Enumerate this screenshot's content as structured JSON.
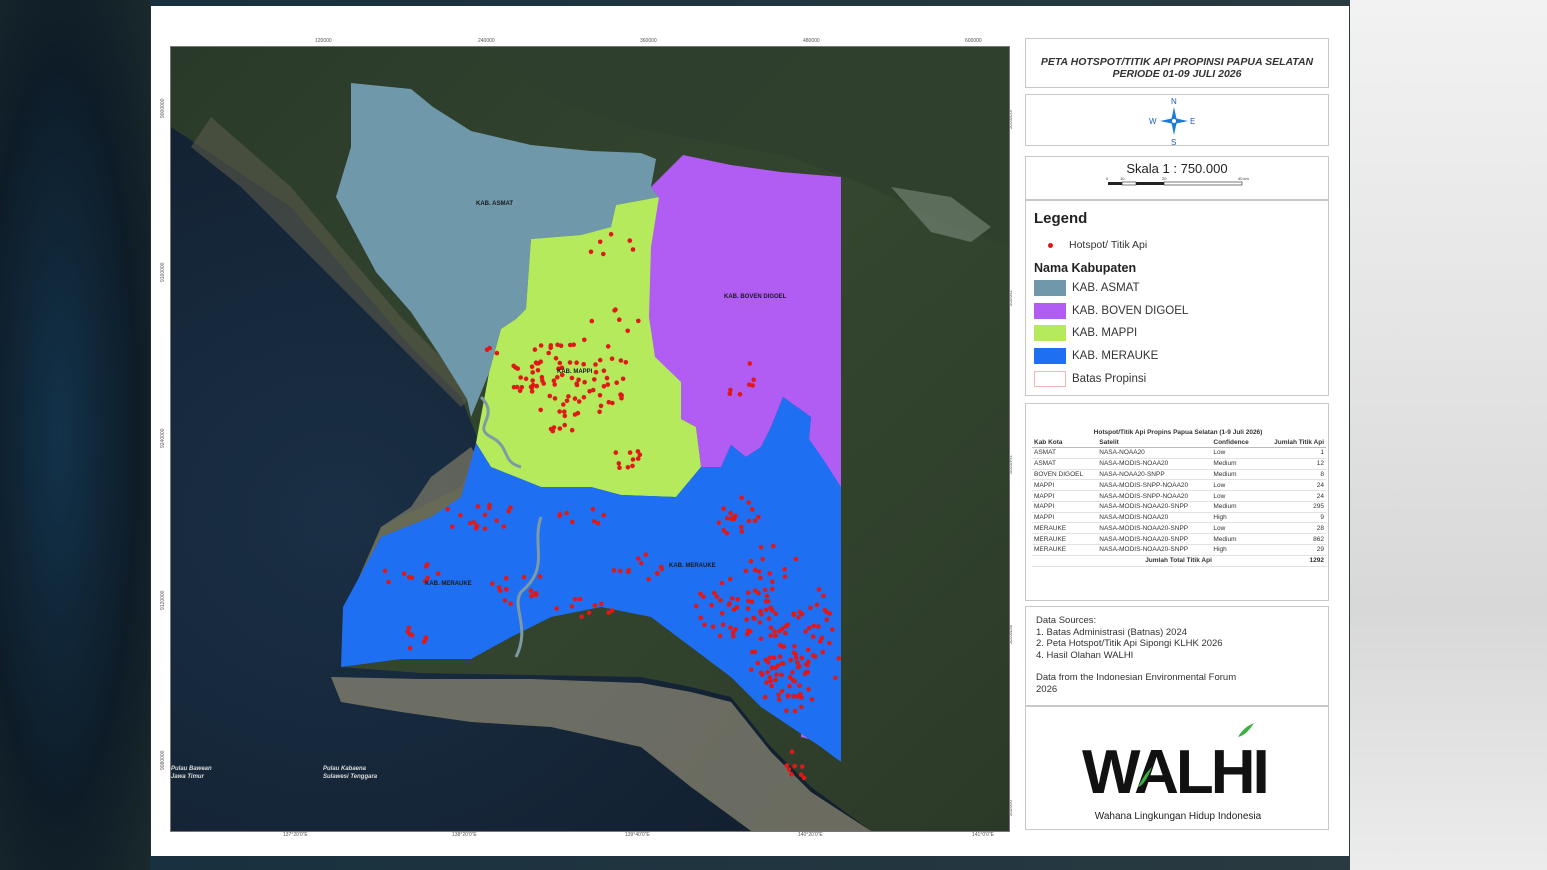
{
  "map": {
    "title_line1": "PETA HOTSPOT/TITIK API PROPINSI PAPUA SELATAN",
    "title_line2": "PERIODE 01-09 JULI 2026",
    "north_arrow": {
      "icon": "compass-rose-icon",
      "n": "N",
      "s": "S",
      "e": "E",
      "w": "W"
    },
    "scale": "Skala 1 : 750.000",
    "scale_bar_ticks": [
      "0",
      "10",
      "20",
      "40 km"
    ],
    "grid_ticks_top": [
      "120000",
      "240000",
      "360000",
      "480000",
      "600000"
    ],
    "grid_ticks_bottom": [
      "137°20'0\"E",
      "138°20'0\"E",
      "139°40'0\"E",
      "140°20'0\"E",
      "141°0'0\"E"
    ],
    "grid_ticks_left": [
      "9000000",
      "9160000",
      "9240000",
      "9120000",
      "9080000"
    ],
    "grid_ticks_right": [
      "6°20'0\"S",
      "7°0'0\"S",
      "7°40'0\"S",
      "8°20'0\"S",
      "9°0'0\"S"
    ],
    "region_labels": {
      "asmat": "KAB. ASMAT",
      "boven": "KAB. BOVEN DIGOEL",
      "mappi": "KAB. MAPPI",
      "merauke_w": "KAB. MERAUKE",
      "merauke_e": "KAB. MERAUKE"
    },
    "sea_label_1a": "Pulau Bawean",
    "sea_label_1b": "Jawa Timur",
    "sea_label_2a": "Pulau Kabaena",
    "sea_label_2b": "Sulawesi Tenggara",
    "colors": {
      "asmat": "#6f99ab",
      "boven": "#b15cf2",
      "mappi": "#b5ea5c",
      "merauke": "#1f6ff2",
      "hotspot": "#e01818",
      "batas": "#f2b8b8"
    }
  },
  "legend": {
    "title": "Legend",
    "hotspot_label": "Hotspot/ Titik Api",
    "kab_title": "Nama Kabupaten",
    "items": [
      {
        "label": "KAB. ASMAT",
        "color": "#6f99ab"
      },
      {
        "label": "KAB. BOVEN DIGOEL",
        "color": "#b15cf2"
      },
      {
        "label": "KAB. MAPPI",
        "color": "#b5ea5c"
      },
      {
        "label": "KAB. MERAUKE",
        "color": "#1f6ff2"
      },
      {
        "label": "Batas Propinsi",
        "color": "#ffffff"
      }
    ]
  },
  "table": {
    "title": "Hotspot/Titik Api Propins Papua Selatan (1-9 Juli 2026)",
    "headers": [
      "Kab Kota",
      "Satelit",
      "Confidence",
      "Jumlah Titik Api"
    ],
    "rows": [
      [
        "ASMAT",
        "NASA-NOAA20",
        "Low",
        "1"
      ],
      [
        "ASMAT",
        "NASA-MODIS-NOAA20",
        "Medium",
        "12"
      ],
      [
        "BOVEN DIGOEL",
        "NASA-NOAA20-SNPP",
        "Medium",
        "8"
      ],
      [
        "MAPPI",
        "NASA-MODIS-SNPP-NOAA20",
        "Low",
        "24"
      ],
      [
        "MAPPI",
        "NASA-MODIS-SNPP-NOAA20",
        "Low",
        "24"
      ],
      [
        "MAPPI",
        "NASA-MODIS-NOAA20-SNPP",
        "Medium",
        "295"
      ],
      [
        "MAPPI",
        "NASA-MODIS-NOAA20",
        "High",
        "9"
      ],
      [
        "MERAUKE",
        "NASA-MODIS-NOAA20-SNPP",
        "Low",
        "28"
      ],
      [
        "MERAUKE",
        "NASA-MODIS-NOAA20-SNPP",
        "Medium",
        "862"
      ],
      [
        "MERAUKE",
        "NASA-MODIS-NOAA20-SNPP",
        "High",
        "29"
      ]
    ],
    "total_label": "Jumlah Total Titik Api",
    "total_value": "1292"
  },
  "sources": {
    "title": "Data Sources:",
    "items": [
      "1. Batas Administrasi (Batnas) 2024",
      "2. Peta Hotspot/Titik Api Sipongi KLHK 2026",
      "4. Hasil Olahan WALHI"
    ],
    "credit_line1": "Data from the Indonesian Environmental Forum",
    "credit_line2": "2026"
  },
  "logo": {
    "wordmark": "WALHI",
    "tagline": "Wahana Lingkungan Hidup Indonesia"
  }
}
